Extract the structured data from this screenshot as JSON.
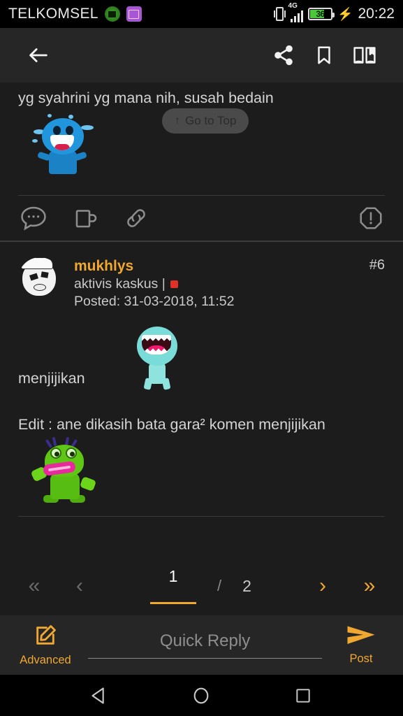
{
  "status_bar": {
    "carrier": "TELKOMSEL",
    "network_type": "4G",
    "battery_level": "36",
    "clock": "20:22",
    "icons": [
      "app-notification-icon",
      "gallery-notification-icon",
      "vibrate-icon",
      "signal-bars-icon",
      "battery-icon",
      "charging-bolt-icon"
    ]
  },
  "toolbar": {
    "back_label": "back-arrow",
    "share_label": "share",
    "bookmark_label": "bookmark",
    "book_label": "read-mode"
  },
  "go_to_top": {
    "arrow": "↑",
    "label": "Go to Top"
  },
  "previous_post": {
    "body_text": "yg syahrini yg mana nih, susah bedain",
    "emoticon": "blue-laughing-emoticon",
    "actions": [
      {
        "name": "comment-icon",
        "label": "Comment"
      },
      {
        "name": "cendol-mug-icon",
        "label": "Cendol"
      },
      {
        "name": "link-icon",
        "label": "Copy Link"
      },
      {
        "name": "report-icon",
        "label": "Report"
      }
    ]
  },
  "post": {
    "username": "mukhlys",
    "user_title": "aktivis kaskus |",
    "reputation_color": "#e03126",
    "posted_label": "Posted: 31-03-2018, 11:52",
    "post_number": "#6",
    "avatar": "meme-face-avatar",
    "line1": "menjijikan",
    "emoticon1": "cyan-open-mouth-emoticon",
    "line2": "Edit : ane dikasih bata gara² komen menjijikan",
    "emoticon2": "green-frog-emoticon"
  },
  "pagination": {
    "first": "«",
    "prev": "‹",
    "current_page": "1",
    "separator": "/",
    "total_pages": "2",
    "next": "›",
    "last": "»"
  },
  "reply_bar": {
    "advanced_label": "Advanced",
    "quick_reply_placeholder": "Quick Reply",
    "quick_reply_value": "",
    "post_label": "Post"
  },
  "nav_bar": {
    "back": "nav-back-icon",
    "home": "nav-home-icon",
    "recents": "nav-recents-icon"
  },
  "theme": {
    "accent": "#f0a830",
    "background": "#1c1c1c",
    "surface": "#262626",
    "text_primary": "#d4d4d4"
  }
}
